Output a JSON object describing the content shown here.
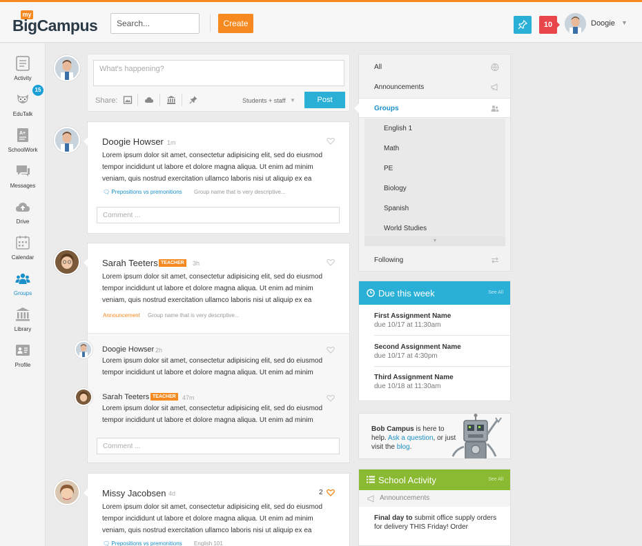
{
  "topbar": {
    "logo_my": "my",
    "logo_big": "Big",
    "logo_campus": "Campus",
    "search_placeholder": "Search...",
    "create_label": "Create",
    "notification_count": "10",
    "user_name": "Doogie"
  },
  "nav": [
    {
      "label": "Activity",
      "icon": "activity-icon"
    },
    {
      "label": "EduTalk",
      "icon": "owl-icon"
    },
    {
      "label": "SchoolWork",
      "icon": "schoolwork-icon",
      "badge": "15"
    },
    {
      "label": "Messages",
      "icon": "messages-icon"
    },
    {
      "label": "Drive",
      "icon": "cloud-upload-icon"
    },
    {
      "label": "Calendar",
      "icon": "calendar-icon"
    },
    {
      "label": "Groups",
      "icon": "groups-icon",
      "active": true
    },
    {
      "label": "Library",
      "icon": "library-icon"
    },
    {
      "label": "Profile",
      "icon": "profile-card-icon"
    }
  ],
  "composer": {
    "placeholder": "What's happening?",
    "share_label": "Share:",
    "audience": "Students + staff",
    "post_label": "Post"
  },
  "posts": [
    {
      "author": "Doogie Howser",
      "time": "1m",
      "body": "Lorem ipsum dolor sit amet, consectetur adipisicing elit, sed do eiusmod tempor incididunt ut labore et dolore magna aliqua. Ut enim ad minim veniam, quis nostrud exercitation ullamco laboris nisi ut aliquip ex ea",
      "link": "Prepositions vs premonitions",
      "desc": "Group name that is very descriptive...",
      "comment_placeholder": "Comment ..."
    },
    {
      "author": "Sarah Teeters",
      "tag": "TEACHER",
      "time": "3h",
      "body": "Lorem ipsum dolor sit amet, consectetur adipisicing elit, sed do eiusmod tempor incididunt ut labore et dolore magna aliqua. Ut enim ad minim veniam, quis nostrud exercitation ullamco laboris nisi ut aliquip ex ea",
      "link": "Announcement",
      "desc": "Group name that is very descriptive...",
      "replies": [
        {
          "author": "Doogie Howser",
          "time": "2h",
          "body": "Lorem ipsum dolor sit amet, consectetur adipisicing elit, sed do eiusmod tempor incididunt ut labore et dolore magna aliqua. Ut enim ad minim"
        },
        {
          "author": "Sarah Teeters",
          "tag": "TEACHER",
          "time": "47m",
          "body": "Lorem ipsum dolor sit amet, consectetur adipisicing elit, sed do eiusmod tempor incididunt ut labore et dolore magna aliqua. Ut enim ad minim"
        }
      ],
      "comment_placeholder": "Comment ..."
    },
    {
      "author": "Missy Jacobsen",
      "time": "4d",
      "likes": "2",
      "body": "Lorem ipsum dolor sit amet, consectetur adipisicing elit, sed do eiusmod tempor incididunt ut labore et dolore magna aliqua. Ut enim ad minim veniam, quis nostrud exercitation ullamco laboris nisi ut aliquip ex ea",
      "link": "Prepositions vs premonitions",
      "desc": "English 101"
    }
  ],
  "filters": {
    "all": "All",
    "announcements": "Announcements",
    "groups": "Groups",
    "group_list": [
      "English 1",
      "Math",
      "PE",
      "Biology",
      "Spanish",
      "World Studies"
    ],
    "following": "Following"
  },
  "due": {
    "title": "Due this week",
    "see_all": "See All",
    "items": [
      {
        "name": "First Assignment Name",
        "date": "due 10/17 at 11:30am"
      },
      {
        "name": "Second Assignment Name",
        "date": "due 10/17 at 4:30pm"
      },
      {
        "name": "Third Assignment Name",
        "date": "due 10/18 at 11:30am"
      }
    ]
  },
  "bob": {
    "name": "Bob Campus",
    "text1": " is here to help. ",
    "ask": "Ask a question",
    "text2": ", or just visit the ",
    "blog": "blog",
    "end": "."
  },
  "activity": {
    "title": "School Activity",
    "see_all": "See All",
    "sub": "Announcements",
    "item_bold": "Final day to",
    "item_text": " submit office supply orders for delivery THIS Friday! Order"
  },
  "colors": {
    "brand_orange": "#f6891f",
    "accent_blue": "#2ab0d7",
    "alert_red": "#e8464b",
    "activity_green": "#8ab932"
  }
}
